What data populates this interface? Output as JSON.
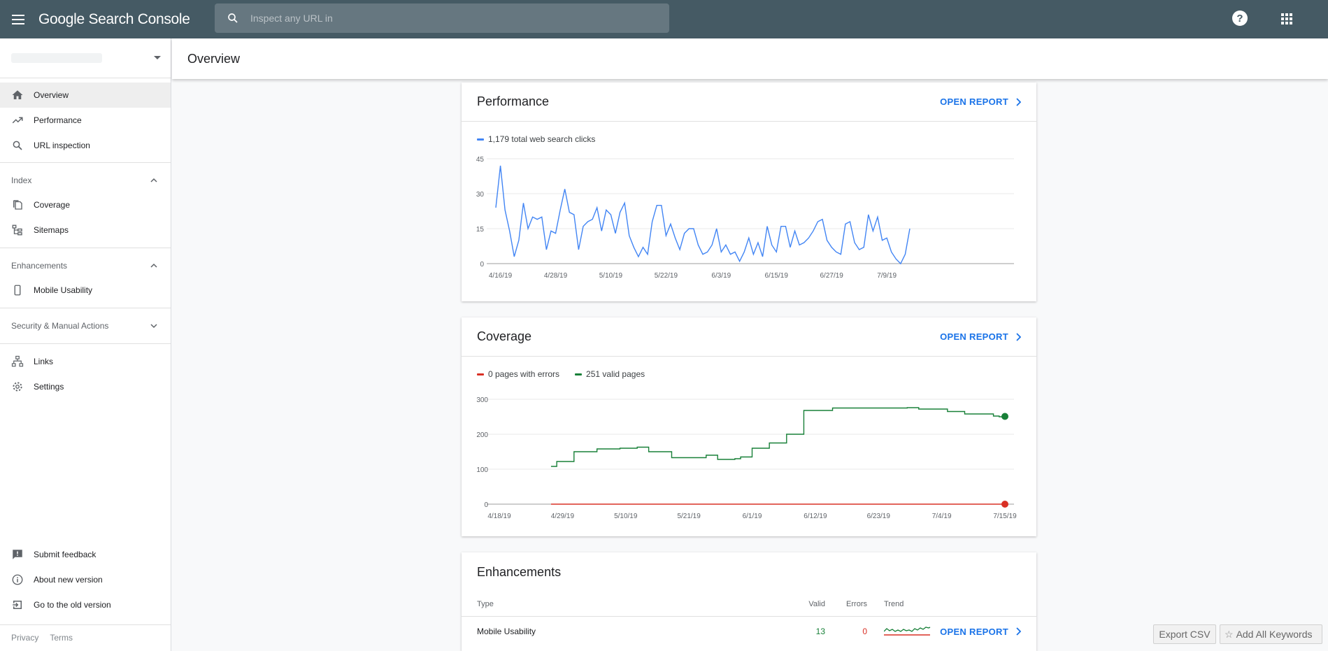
{
  "app": {
    "title": "Google Search Console"
  },
  "search": {
    "placeholder": "Inspect any URL in"
  },
  "header": {
    "help_label": "?"
  },
  "sidebar": {
    "items_top": [
      {
        "label": "Overview",
        "icon": "home-icon",
        "active": true
      },
      {
        "label": "Performance",
        "icon": "trending-up-icon"
      },
      {
        "label": "URL inspection",
        "icon": "search-icon"
      }
    ],
    "index": {
      "label": "Index",
      "items": [
        {
          "label": "Coverage",
          "icon": "copy-icon"
        },
        {
          "label": "Sitemaps",
          "icon": "sitemap-icon"
        }
      ]
    },
    "enhancements": {
      "label": "Enhancements",
      "items": [
        {
          "label": "Mobile Usability",
          "icon": "phone-icon"
        }
      ]
    },
    "security": {
      "label": "Security & Manual Actions"
    },
    "items_links": [
      {
        "label": "Links",
        "icon": "links-icon"
      },
      {
        "label": "Settings",
        "icon": "gear-icon"
      }
    ],
    "items_bottom": [
      {
        "label": "Submit feedback",
        "icon": "feedback-icon"
      },
      {
        "label": "About new version",
        "icon": "info-icon"
      },
      {
        "label": "Go to the old version",
        "icon": "exit-icon"
      }
    ],
    "footer": {
      "privacy": "Privacy",
      "terms": "Terms"
    }
  },
  "main": {
    "title": "Overview"
  },
  "performance": {
    "title": "Performance",
    "open_report": "OPEN REPORT",
    "legend": "1,179 total web search clicks",
    "color": "#4285f4"
  },
  "coverage": {
    "title": "Coverage",
    "open_report": "OPEN REPORT",
    "legend_errors": "0 pages with errors",
    "legend_valid": "251 valid pages",
    "error_color": "#d93025",
    "valid_color": "#188038"
  },
  "enhancements": {
    "title": "Enhancements",
    "headers": {
      "type": "Type",
      "valid": "Valid",
      "errors": "Errors",
      "trend": "Trend"
    },
    "rows": [
      {
        "type": "Mobile Usability",
        "valid": "13",
        "errors": "0",
        "open_report": "OPEN REPORT"
      }
    ]
  },
  "overlay_buttons": {
    "export_csv": "Export CSV",
    "add_keywords": "Add All Keywords"
  },
  "chart_data": [
    {
      "type": "line",
      "name": "performance",
      "ylim": [
        0,
        45
      ],
      "yticks": [
        0,
        15,
        30,
        45
      ],
      "xtick_labels": [
        "4/16/19",
        "4/28/19",
        "5/10/19",
        "5/22/19",
        "6/3/19",
        "6/15/19",
        "6/27/19",
        "7/9/19"
      ],
      "x_start": "4/15/19",
      "series": [
        {
          "name": "1,179 total web search clicks",
          "color": "#4285f4",
          "values": [
            24,
            42,
            23,
            14,
            3,
            10,
            26,
            15,
            20,
            19,
            20,
            6,
            14,
            13,
            23,
            32,
            22,
            21,
            6,
            16,
            18,
            19,
            24,
            14,
            23,
            21,
            13,
            22,
            26,
            12,
            7,
            3,
            7,
            4,
            18,
            25,
            25,
            12,
            17,
            11,
            6,
            13,
            15,
            15,
            8,
            4,
            5,
            8,
            15,
            5,
            8,
            4,
            5,
            1,
            5,
            11,
            4,
            9,
            3,
            16,
            8,
            5,
            16,
            16,
            7,
            14,
            8,
            9,
            11,
            14,
            18,
            19,
            10,
            7,
            5,
            4,
            17,
            18,
            9,
            6,
            7,
            21,
            14,
            20,
            10,
            11,
            5,
            2,
            0,
            4,
            15
          ]
        }
      ]
    },
    {
      "type": "line",
      "name": "coverage",
      "ylim": [
        0,
        300
      ],
      "yticks": [
        0,
        100,
        200,
        300
      ],
      "xtick_labels": [
        "4/18/19",
        "4/29/19",
        "5/10/19",
        "5/21/19",
        "6/1/19",
        "6/12/19",
        "6/23/19",
        "7/4/19",
        "7/15/19"
      ],
      "x_start": "4/18/19",
      "series": [
        {
          "name": "251 valid pages",
          "color": "#188038",
          "x": [
            9,
            10,
            12,
            13,
            14,
            15,
            16,
            17,
            18,
            19,
            20,
            21,
            22,
            23,
            24,
            25,
            26,
            27,
            28,
            29,
            30,
            31,
            32,
            33,
            34,
            35,
            36,
            37,
            38,
            39,
            40,
            41,
            42,
            43,
            44,
            45,
            46,
            47,
            48,
            49,
            50,
            51,
            52,
            53,
            54,
            55,
            56,
            57,
            58,
            59,
            60,
            61,
            62,
            63,
            64,
            65,
            66,
            67,
            68,
            69,
            70,
            71,
            72,
            73,
            74,
            75,
            76,
            77,
            78,
            79,
            80,
            81,
            82,
            83,
            84,
            85,
            86,
            87,
            88
          ],
          "values": [
            108,
            122,
            122,
            150,
            150,
            150,
            150,
            158,
            158,
            158,
            158,
            160,
            160,
            160,
            163,
            163,
            150,
            150,
            150,
            150,
            133,
            133,
            133,
            133,
            133,
            133,
            140,
            140,
            128,
            128,
            128,
            130,
            135,
            135,
            160,
            160,
            160,
            175,
            175,
            175,
            200,
            200,
            200,
            268,
            268,
            268,
            268,
            268,
            275,
            275,
            275,
            275,
            275,
            275,
            275,
            275,
            275,
            275,
            275,
            275,
            275,
            276,
            276,
            272,
            272,
            272,
            272,
            272,
            265,
            265,
            265,
            258,
            258,
            258,
            258,
            258,
            252,
            250,
            251
          ]
        },
        {
          "name": "0 pages with errors",
          "color": "#d93025",
          "x": [
            9,
            88
          ],
          "values": [
            0,
            0
          ]
        }
      ]
    }
  ]
}
